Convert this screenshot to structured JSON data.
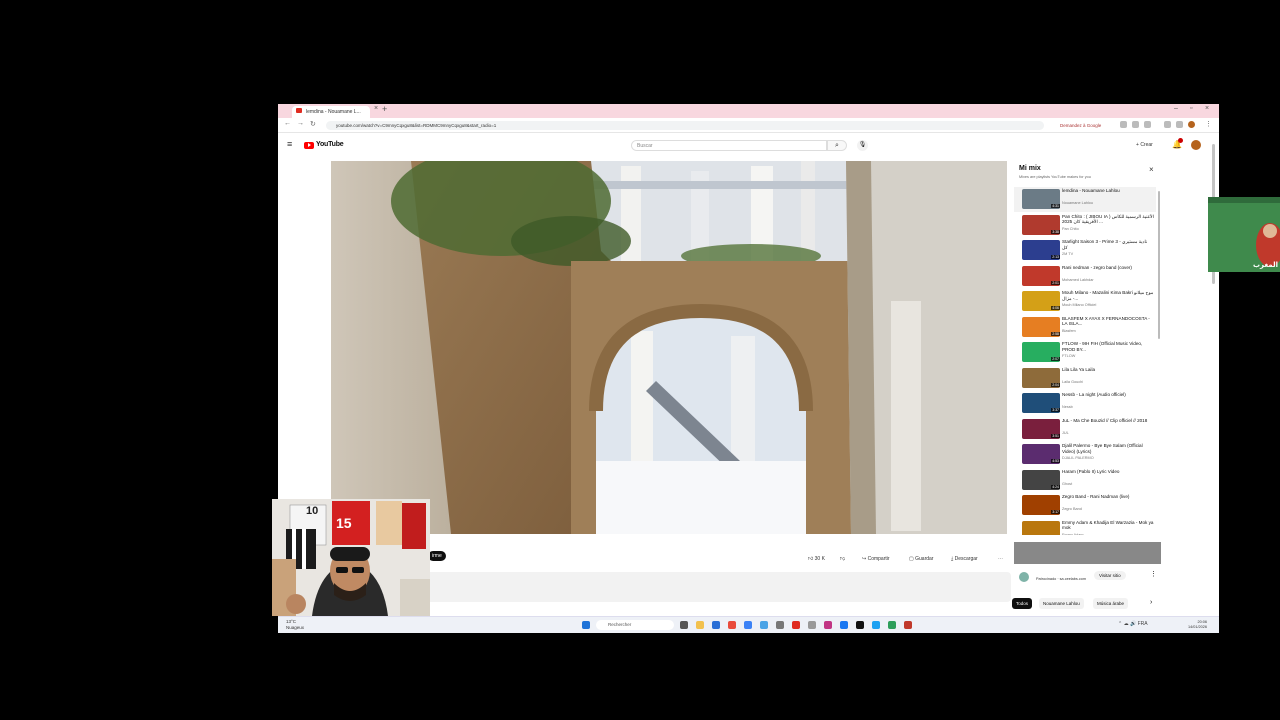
{
  "browser": {
    "tab_title": "lemdina - Nouamane L...",
    "url": "youtube.com/watch?v=C9mnyCqxgu8&list=RDMMC9mnyCqxgu8&start_radio=1",
    "google_pill": "Demandez à Google"
  },
  "header": {
    "logo_text": "YouTube",
    "search_placeholder": "Buscar",
    "create_label": "Crear",
    "notification_count": "9+"
  },
  "actions": {
    "likes": "30 K",
    "share": "Compartir",
    "save": "Guardar",
    "download": "Descargar",
    "subscribe_partial": "irme"
  },
  "playlist": {
    "title": "Mi mix",
    "subtitle": "Mixes are playlists YouTube makes for you",
    "items": [
      {
        "title": "lemdina - Nouamane Lahlou",
        "channel": "Nouamane Lahlou",
        "duration": "4:31",
        "color": "#6b7b86"
      },
      {
        "title": "Pan Chito : ( JIBOU IA ) الأغنية الرسمية للكأس الأفريقية كان 2025 ...",
        "channel": "Pan Chito",
        "duration": "3:38",
        "color": "#b03a2e"
      },
      {
        "title": "Starlight Saison 3 - Prime 3 - نادية مستيري كل",
        "channel": "2M TV",
        "duration": "2:13",
        "color": "#2c3e8f"
      },
      {
        "title": "Rani nedman - zegro band (cover)",
        "channel": "Mohamed Lakhdar",
        "duration": "2:01",
        "color": "#c0392b"
      },
      {
        "title": "Mouh Milano - Mazalini Kima Bakri موح ميلانو - مزال...",
        "channel": "Mouh Milano Officiel",
        "duration": "4:06",
        "color": "#d4a017"
      },
      {
        "title": "BLASFEM X AYAX X FERNANDOCOSTA - LA ISLA...",
        "channel": "Blasfem",
        "duration": "2:58",
        "color": "#e67e22"
      },
      {
        "title": "FTLOW - 9IH FIH (Official Music Video, PROD BY...",
        "channel": "FTLOW",
        "duration": "2:07",
        "color": "#27ae60"
      },
      {
        "title": "Lila Lila Ya Laila",
        "channel": "Laila Gouchi",
        "duration": "2:04",
        "color": "#8e6b3a"
      },
      {
        "title": "Nessb - La night (Audio officiel)",
        "channel": "Nessb",
        "duration": "3:37",
        "color": "#1f4e79"
      },
      {
        "title": "JuL - Ma Che Bouzid // Clip officiel // 2018",
        "channel": "JUL",
        "duration": "3:51",
        "color": "#7a1f3d"
      },
      {
        "title": "Djalil Palermo - Bye Bye Salam (Official Video) (Lyrics)",
        "channel": "DJALIL PALERMO",
        "duration": "4:53",
        "color": "#5b2c6f"
      },
      {
        "title": "Haram (Pablo II) Lyric Video",
        "channel": "Ghost",
        "duration": "4:24",
        "color": "#444444"
      },
      {
        "title": "Zegro Band - Rani Nadman (live)",
        "channel": "Zegro Band",
        "duration": "3:17",
        "color": "#a04000"
      },
      {
        "title": "Emmy Adam & Khadija El Warzazia - Mok ya mok",
        "channel": "Emmy Adam",
        "duration": "4:35",
        "color": "#b9770e"
      }
    ]
  },
  "ad": {
    "visit_site": "Visitar sitio",
    "sponsored": "Patrocinado",
    "domain": "sa.ceelabs.com"
  },
  "chips": [
    "Todos",
    "Nouamane Lahlou",
    "Música árabe"
  ],
  "taskbar": {
    "weather_line1": "13°C",
    "weather_line2": "Nuageux",
    "search": "Rechercher",
    "lang": "FRA",
    "time": "20:06",
    "date": "14/01/2026"
  },
  "webcam": {
    "jersey_number_1": "10",
    "jersey_number_2": "15"
  }
}
